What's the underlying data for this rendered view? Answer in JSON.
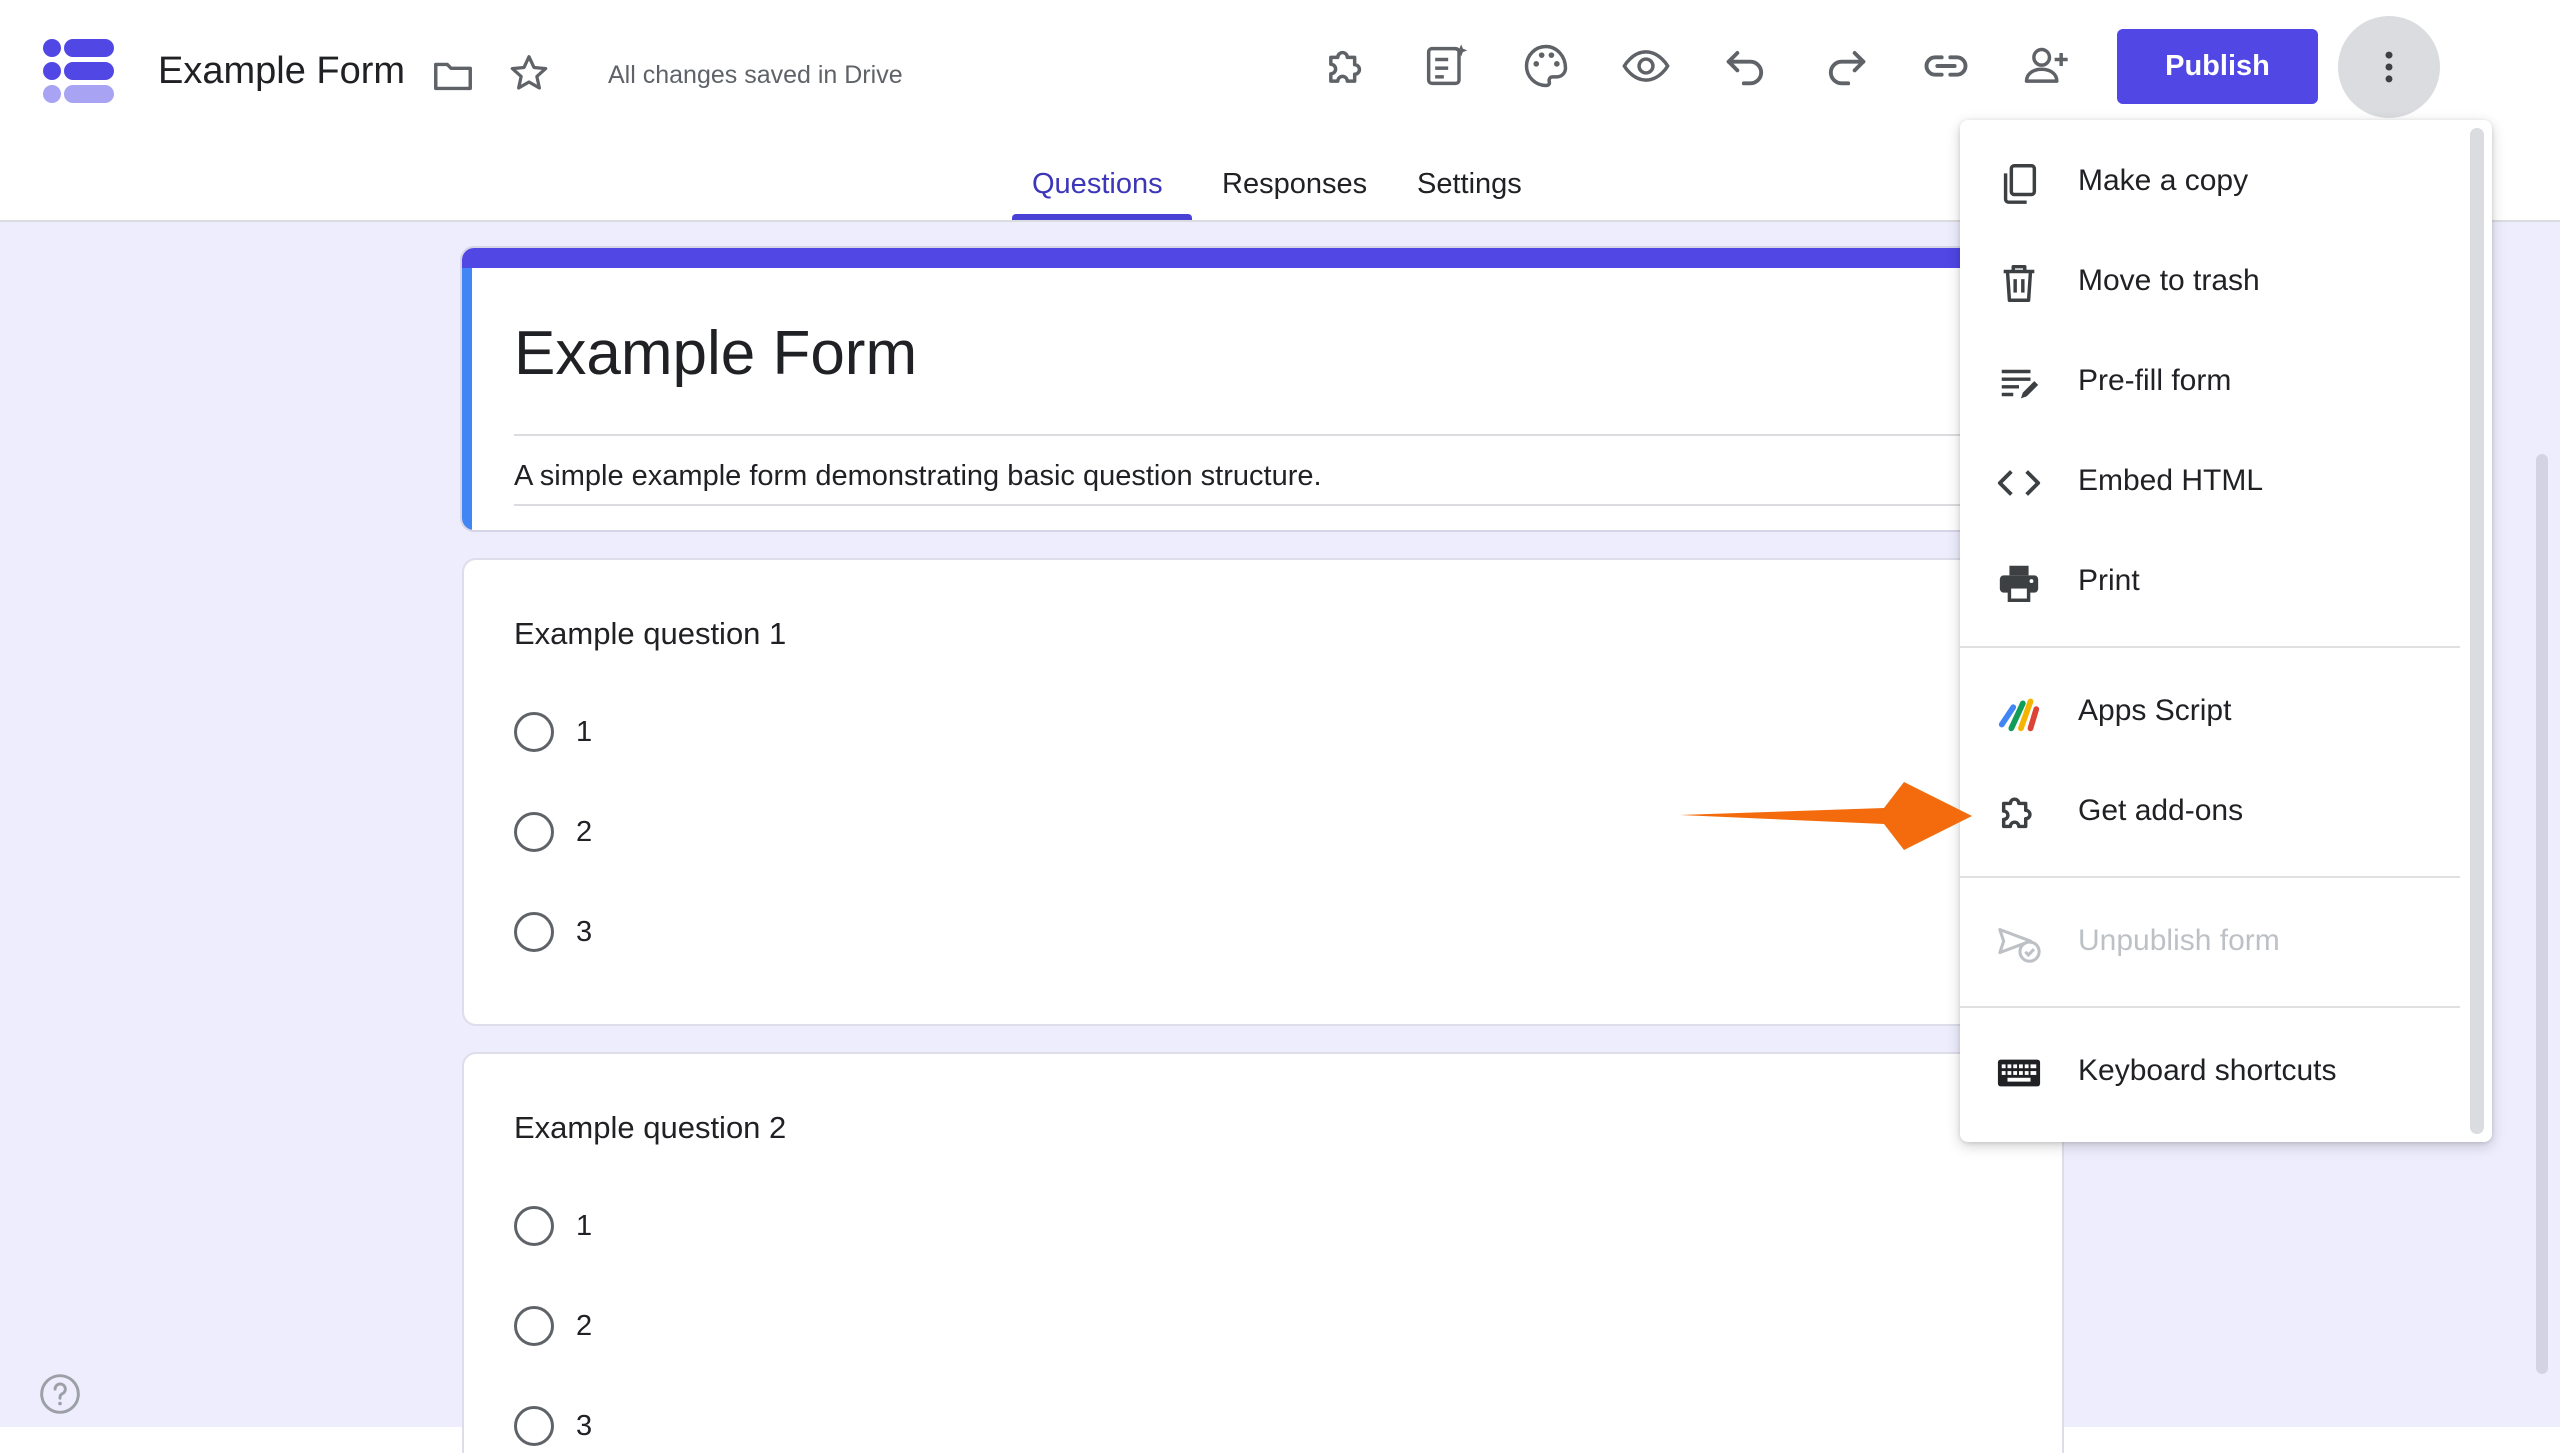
{
  "header": {
    "form_name": "Example Form",
    "save_status": "All changes saved in Drive",
    "publish_label": "Publish",
    "toolbar_icons": [
      "add-ons-icon",
      "ai-form-icon",
      "palette-icon",
      "preview-eye-icon",
      "undo-icon",
      "redo-icon",
      "link-icon",
      "add-collaborator-icon"
    ]
  },
  "tabs": [
    {
      "label": "Questions",
      "active": true
    },
    {
      "label": "Responses",
      "active": false
    },
    {
      "label": "Settings",
      "active": false
    }
  ],
  "form": {
    "title": "Example Form",
    "description": "A simple example form demonstrating basic question structure."
  },
  "questions": [
    {
      "title": "Example question 1",
      "options": [
        "1",
        "2",
        "3"
      ]
    },
    {
      "title": "Example question 2",
      "options": [
        "1",
        "2",
        "3"
      ]
    }
  ],
  "menu": {
    "items": [
      {
        "label": "Make a copy",
        "icon": "copy-icon",
        "disabled": false
      },
      {
        "label": "Move to trash",
        "icon": "trash-icon",
        "disabled": false
      },
      {
        "label": "Pre-fill form",
        "icon": "prefill-icon",
        "disabled": false
      },
      {
        "label": "Embed HTML",
        "icon": "code-icon",
        "disabled": false
      },
      {
        "label": "Print",
        "icon": "print-icon",
        "disabled": false
      },
      {
        "label": "Apps Script",
        "icon": "apps-script-icon",
        "disabled": false
      },
      {
        "label": "Get add-ons",
        "icon": "add-ons-icon",
        "disabled": false
      },
      {
        "label": "Unpublish form",
        "icon": "unpublish-icon",
        "disabled": true
      },
      {
        "label": "Keyboard shortcuts",
        "icon": "keyboard-icon",
        "disabled": false
      }
    ]
  },
  "colors": {
    "brand": "#5047e5",
    "active_tab": "#3c36b8",
    "background": "#eeedfd",
    "annotation_arrow": "#f36b0d"
  }
}
